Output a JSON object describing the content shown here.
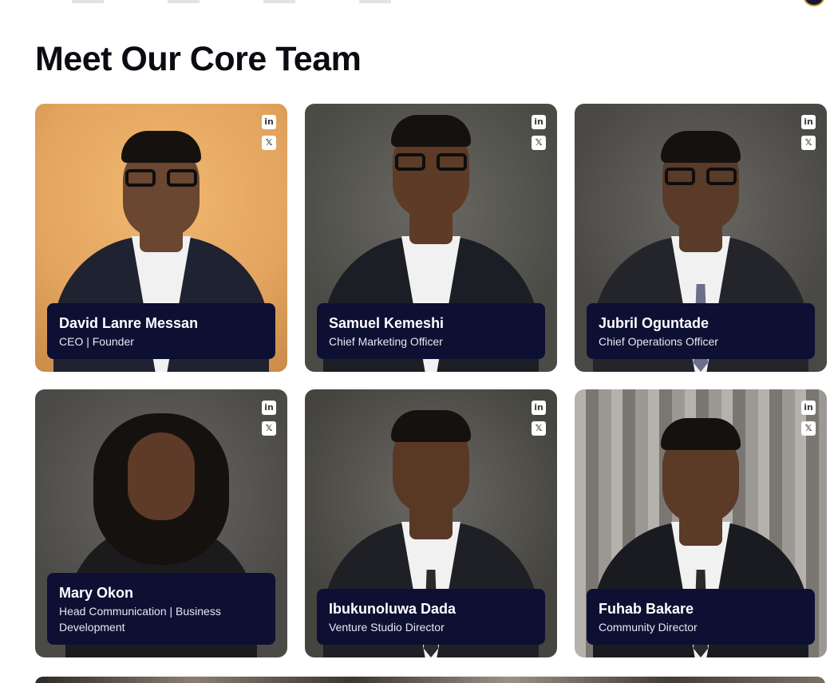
{
  "page": {
    "title": "Meet Our Core Team"
  },
  "social_icons": {
    "linkedin": "linkedin-icon",
    "x": "x-twitter-icon"
  },
  "team": [
    {
      "name": "David Lanre Messan",
      "role": "CEO | Founder",
      "bg": "#e3a45f",
      "skin": "#6b4631"
    },
    {
      "name": "Samuel Kemeshi",
      "role": "Chief Marketing Officer",
      "bg": "#4b4b46",
      "skin": "#5d3b26"
    },
    {
      "name": "Jubril Oguntade",
      "role": "Chief Operations Officer",
      "bg": "#4a4845",
      "skin": "#5a3a28"
    },
    {
      "name": "Mary Okon",
      "role": "Head Communication | Business Development",
      "bg": "#4c4a47",
      "skin": "#5e3a28"
    },
    {
      "name": "Ibukunoluwa Dada",
      "role": "Venture Studio Director",
      "bg": "#45443f",
      "skin": "#5a3826"
    },
    {
      "name": "Fuhab Bakare",
      "role": "Community Director",
      "bg": "#8d8a86",
      "skin": "#5b3a27"
    }
  ]
}
